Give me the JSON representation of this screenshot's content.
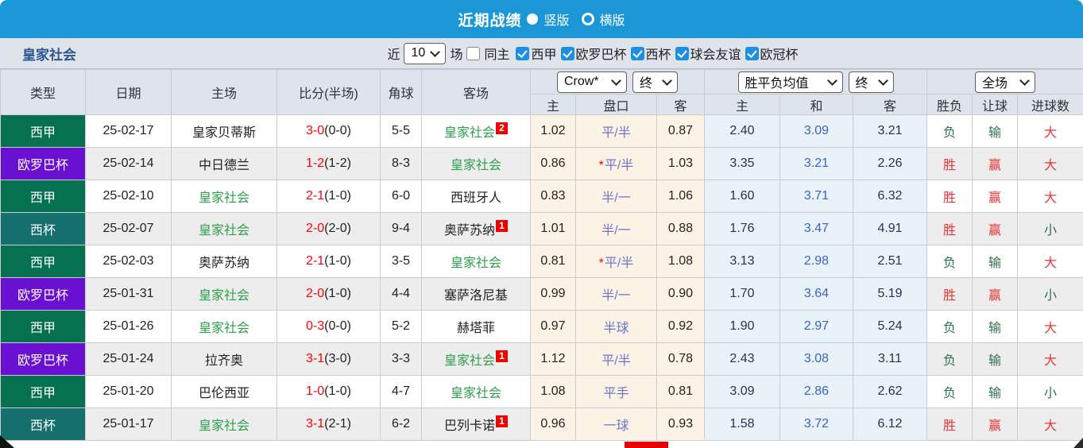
{
  "titlebar": {
    "title": "近期战绩",
    "radio_vertical": "竖版",
    "radio_horizontal": "横版",
    "selected": "竖版"
  },
  "filters": {
    "team": "皇家社会",
    "near_label": "近",
    "match_count": "10",
    "games_label": "场",
    "same_home_label": "同主",
    "same_home_checked": false,
    "leagues": [
      {
        "label": "西甲",
        "checked": true
      },
      {
        "label": "欧罗巴杯",
        "checked": true
      },
      {
        "label": "西杯",
        "checked": true
      },
      {
        "label": "球会友谊",
        "checked": true
      },
      {
        "label": "欧冠杯",
        "checked": true
      }
    ]
  },
  "table": {
    "headers": {
      "type": "类型",
      "date": "日期",
      "home": "主场",
      "score": "比分(半场)",
      "corners": "角球",
      "away": "客场",
      "asia_home": "主",
      "asia_handicap": "盘口",
      "asia_away": "客",
      "avg_home": "主",
      "avg_draw": "和",
      "avg_away": "客",
      "result": "胜负",
      "handicap_result": "让球",
      "goals": "进球数"
    },
    "selects": {
      "company": "Crow*",
      "asia_time": "终",
      "avg_label": "胜平负均值",
      "avg_time": "终",
      "scope": "全场"
    },
    "rows": [
      {
        "type": "西甲",
        "date": "25-02-17",
        "home": "皇家贝蒂斯",
        "home_self": false,
        "score": "3-0",
        "half": "(0-0)",
        "corners": "5-5",
        "away": "皇家社会",
        "away_self": true,
        "away_badge": "2",
        "asia_home": "1.02",
        "handicap": "平/半",
        "handicap_star": false,
        "asia_away": "0.87",
        "avg_home": "2.40",
        "avg_draw": "3.09",
        "avg_away": "3.21",
        "result": "负",
        "let_result": "输",
        "goals": "大"
      },
      {
        "type": "欧罗巴杯",
        "date": "25-02-14",
        "home": "中日德兰",
        "home_self": false,
        "score": "1-2",
        "half": "(1-2)",
        "corners": "8-3",
        "away": "皇家社会",
        "away_self": true,
        "away_badge": "",
        "asia_home": "0.86",
        "handicap": "平/半",
        "handicap_star": true,
        "asia_away": "1.03",
        "avg_home": "3.35",
        "avg_draw": "3.21",
        "avg_away": "2.26",
        "result": "胜",
        "let_result": "赢",
        "goals": "大"
      },
      {
        "type": "西甲",
        "date": "25-02-10",
        "home": "皇家社会",
        "home_self": true,
        "score": "2-1",
        "half": "(1-0)",
        "corners": "6-0",
        "away": "西班牙人",
        "away_self": false,
        "away_badge": "",
        "asia_home": "0.83",
        "handicap": "半/一",
        "handicap_star": false,
        "asia_away": "1.06",
        "avg_home": "1.60",
        "avg_draw": "3.71",
        "avg_away": "6.32",
        "result": "胜",
        "let_result": "赢",
        "goals": "大"
      },
      {
        "type": "西杯",
        "date": "25-02-07",
        "home": "皇家社会",
        "home_self": true,
        "score": "2-0",
        "half": "(2-0)",
        "corners": "9-4",
        "away": "奥萨苏纳",
        "away_self": false,
        "away_badge": "1",
        "asia_home": "1.01",
        "handicap": "半/一",
        "handicap_star": false,
        "asia_away": "0.88",
        "avg_home": "1.76",
        "avg_draw": "3.47",
        "avg_away": "4.91",
        "result": "胜",
        "let_result": "赢",
        "goals": "小"
      },
      {
        "type": "西甲",
        "date": "25-02-03",
        "home": "奥萨苏纳",
        "home_self": false,
        "score": "2-1",
        "half": "(1-0)",
        "corners": "3-5",
        "away": "皇家社会",
        "away_self": true,
        "away_badge": "",
        "asia_home": "0.81",
        "handicap": "平/半",
        "handicap_star": true,
        "asia_away": "1.08",
        "avg_home": "3.13",
        "avg_draw": "2.98",
        "avg_away": "2.51",
        "result": "负",
        "let_result": "输",
        "goals": "大"
      },
      {
        "type": "欧罗巴杯",
        "date": "25-01-31",
        "home": "皇家社会",
        "home_self": true,
        "score": "2-0",
        "half": "(1-0)",
        "corners": "4-4",
        "away": "塞萨洛尼基",
        "away_self": false,
        "away_badge": "",
        "asia_home": "0.99",
        "handicap": "半/一",
        "handicap_star": false,
        "asia_away": "0.90",
        "avg_home": "1.70",
        "avg_draw": "3.64",
        "avg_away": "5.19",
        "result": "胜",
        "let_result": "赢",
        "goals": "小"
      },
      {
        "type": "西甲",
        "date": "25-01-26",
        "home": "皇家社会",
        "home_self": true,
        "score": "0-3",
        "half": "(0-0)",
        "corners": "5-2",
        "away": "赫塔菲",
        "away_self": false,
        "away_badge": "",
        "asia_home": "0.97",
        "handicap": "半球",
        "handicap_star": false,
        "asia_away": "0.92",
        "avg_home": "1.90",
        "avg_draw": "2.97",
        "avg_away": "5.24",
        "result": "负",
        "let_result": "输",
        "goals": "大"
      },
      {
        "type": "欧罗巴杯",
        "date": "25-01-24",
        "home": "拉齐奥",
        "home_self": false,
        "score": "3-1",
        "half": "(3-0)",
        "corners": "3-3",
        "away": "皇家社会",
        "away_self": true,
        "away_badge": "1",
        "asia_home": "1.12",
        "handicap": "平/半",
        "handicap_star": false,
        "asia_away": "0.78",
        "avg_home": "2.43",
        "avg_draw": "3.08",
        "avg_away": "3.11",
        "result": "负",
        "let_result": "输",
        "goals": "大"
      },
      {
        "type": "西甲",
        "date": "25-01-20",
        "home": "巴伦西亚",
        "home_self": false,
        "score": "1-0",
        "half": "(1-0)",
        "corners": "4-7",
        "away": "皇家社会",
        "away_self": true,
        "away_badge": "",
        "asia_home": "1.08",
        "handicap": "平手",
        "handicap_star": false,
        "asia_away": "0.81",
        "avg_home": "3.09",
        "avg_draw": "2.86",
        "avg_away": "2.62",
        "result": "负",
        "let_result": "输",
        "goals": "小"
      },
      {
        "type": "西杯",
        "date": "25-01-17",
        "home": "皇家社会",
        "home_self": true,
        "score": "3-1",
        "half": "(2-1)",
        "corners": "6-2",
        "away": "巴列卡诺",
        "away_self": false,
        "away_badge": "1",
        "asia_home": "0.96",
        "handicap": "一球",
        "handicap_star": false,
        "asia_away": "0.93",
        "avg_home": "1.58",
        "avg_draw": "3.72",
        "avg_away": "6.12",
        "result": "胜",
        "let_result": "赢",
        "goals": "大"
      }
    ]
  },
  "colors": {
    "topbar_bg": "#1b97d5",
    "filter_bg": "#dfe3ea",
    "header_bg": "#dde4ee",
    "row_alt_bg": "#ededed",
    "asia_bg": "#fcf3e6",
    "avg_bg": "#e9f2f8",
    "self_team": "#2f9e4e",
    "score_red": "#ff0000",
    "handicap_text": "#6b76c8",
    "avg_draw_text": "#3a63c0",
    "avg_side_text": "#263350",
    "win_red": "#e53535",
    "lose_green": "#2f7050",
    "badge_bg": "#ee0000",
    "type_colors": {
      "西甲": "#067151",
      "欧罗巴杯": "#6a10d0",
      "西杯": "#156f6c"
    },
    "win_values": [
      "胜",
      "赢",
      "大"
    ]
  }
}
